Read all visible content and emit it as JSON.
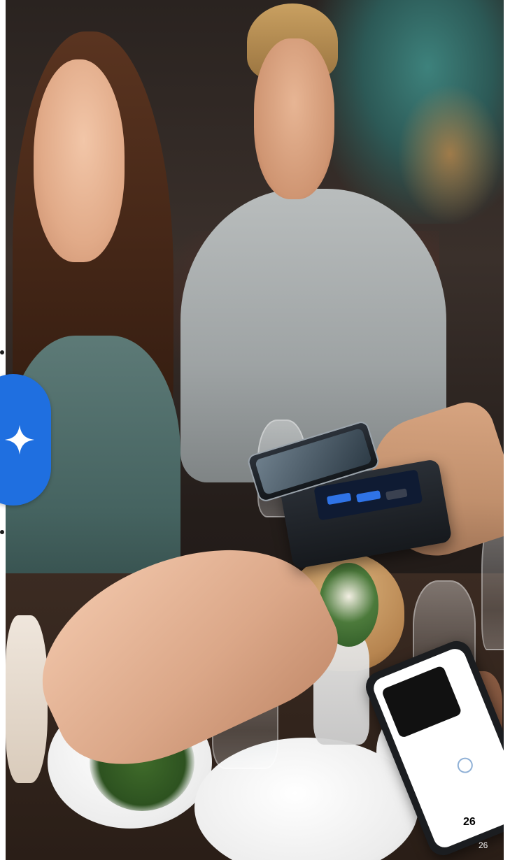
{
  "colors": {
    "accent": "#1f6fe0",
    "background": "#ffffff",
    "page_number_dark": "#000000",
    "page_number_light": "#f4f4f4"
  },
  "photo": {
    "icon": "restaurant-payment-photo"
  },
  "assistant_button": {
    "icon": "sparkle-icon"
  },
  "page_numbers": {
    "primary": "26",
    "secondary": "26"
  }
}
